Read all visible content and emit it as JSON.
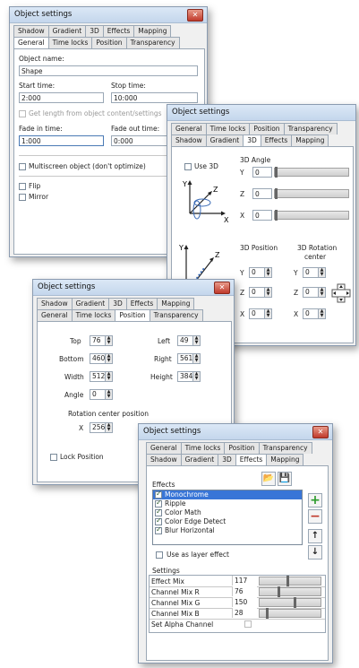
{
  "win1": {
    "title": "Object settings",
    "tabs_top": [
      "Shadow",
      "Gradient",
      "3D",
      "Effects",
      "Mapping"
    ],
    "tabs_bottom": [
      "General",
      "Time locks",
      "Position",
      "Transparency"
    ],
    "object_name_label": "Object name:",
    "object_name_value": "Shape",
    "start_time_label": "Start time:",
    "start_time_value": "2:000",
    "stop_time_label": "Stop time:",
    "stop_time_value": "10:000",
    "get_length_label": "Get length from object content/settings",
    "fade_in_label": "Fade in time:",
    "fade_in_value": "1:000",
    "fade_out_label": "Fade out time:",
    "fade_out_value": "0:000",
    "multiscreen_label": "Multiscreen object (don't optimize)",
    "flip_label": "Flip",
    "mirror_label": "Mirror"
  },
  "win2": {
    "title": "Object settings",
    "tabs_top": [
      "General",
      "Time locks",
      "Position",
      "Transparency"
    ],
    "tabs_bottom": [
      "Shadow",
      "Gradient",
      "3D",
      "Effects",
      "Mapping"
    ],
    "use3d_label": "Use 3D",
    "angle_title": "3D Angle",
    "angle_y_label": "Y",
    "angle_y_value": "0",
    "angle_z_label": "Z",
    "angle_z_value": "0",
    "angle_x_label": "X",
    "angle_x_value": "0",
    "position_title": "3D Position",
    "rotation_title": "3D Rotation center",
    "pos_y_label": "Y",
    "pos_y_value": "0",
    "pos_z_label": "Z",
    "pos_z_value": "0",
    "pos_x_label": "X",
    "pos_x_value": "0",
    "rot_y_label": "Y",
    "rot_y_value": "0",
    "rot_z_label": "Z",
    "rot_z_value": "0",
    "rot_x_label": "X",
    "rot_x_value": "0",
    "axis_y": "Y",
    "axis_z": "Z",
    "axis_x": "X"
  },
  "win3": {
    "title": "Object settings",
    "tabs_top": [
      "Shadow",
      "Gradient",
      "3D",
      "Effects",
      "Mapping"
    ],
    "tabs_bottom": [
      "General",
      "Time locks",
      "Position",
      "Transparency"
    ],
    "top_label": "Top",
    "top_value": "76",
    "left_label": "Left",
    "left_value": "49",
    "bottom_label": "Bottom",
    "bottom_value": "460",
    "right_label": "Right",
    "right_value": "561",
    "width_label": "Width",
    "width_value": "512",
    "height_label": "Height",
    "height_value": "384",
    "angle_label": "Angle",
    "angle_value": "0",
    "rotation_center_label": "Rotation center position",
    "x_label": "X",
    "x_value": "256",
    "lock_label": "Lock Position"
  },
  "win4": {
    "title": "Object settings",
    "tabs_top": [
      "General",
      "Time locks",
      "Position",
      "Transparency"
    ],
    "tabs_bottom": [
      "Shadow",
      "Gradient",
      "3D",
      "Effects",
      "Mapping"
    ],
    "effects_label": "Effects",
    "effects": [
      "Monochrome",
      "Ripple",
      "Color Math",
      "Color Edge Detect",
      "Blur Horizontal"
    ],
    "use_layer_label": "Use as layer effect",
    "settings_label": "Settings",
    "settings": [
      {
        "name": "Effect Mix",
        "value": "117",
        "level": 0.46
      },
      {
        "name": "Channel Mix R",
        "value": "76",
        "level": 0.3
      },
      {
        "name": "Channel Mix G",
        "value": "150",
        "level": 0.59
      },
      {
        "name": "Channel Mix B",
        "value": "28",
        "level": 0.11
      },
      {
        "name": "Set Alpha Channel",
        "value": "",
        "level": null
      }
    ]
  }
}
